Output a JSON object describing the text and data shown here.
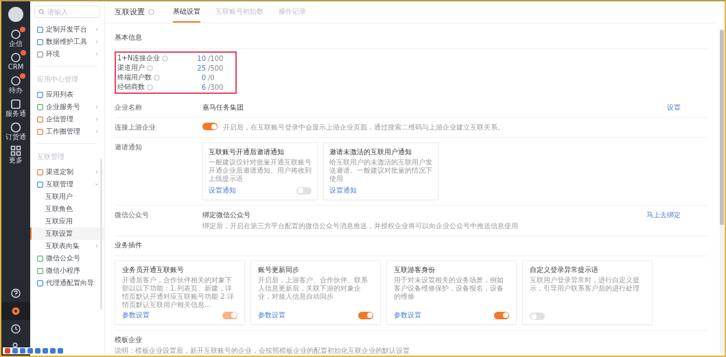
{
  "rail": {
    "items": [
      {
        "label": "企信",
        "badge": true
      },
      {
        "label": "CRM",
        "badge": true
      },
      {
        "label": "待办",
        "badge": true
      },
      {
        "label": "服务通",
        "badge": false
      },
      {
        "label": "订货通",
        "badge": false
      },
      {
        "label": "更多",
        "badge": false
      }
    ],
    "bottom": [
      {
        "selected": false
      },
      {
        "selected": true
      },
      {
        "selected": false
      },
      {
        "selected": false
      }
    ]
  },
  "sidebar": {
    "search": {
      "placeholder": "请输入"
    },
    "groups": [
      {
        "items": [
          {
            "label": "定制开发平台",
            "kind": "submenu",
            "expanded": false,
            "selected": false,
            "color": "#4a8ee0"
          },
          {
            "label": "数据维护工具",
            "kind": "submenu",
            "expanded": false,
            "selected": false,
            "color": "#4a8ee0"
          },
          {
            "label": "环境",
            "kind": "submenu",
            "expanded": false,
            "selected": false,
            "color": "#8a94a6"
          }
        ]
      },
      {
        "title": "应用中心管理",
        "items": [
          {
            "label": "应用列表",
            "kind": "link",
            "selected": false,
            "color": "#4a8ee0"
          },
          {
            "label": "企业服务号",
            "kind": "submenu",
            "expanded": false,
            "selected": false,
            "color": "#52b36b"
          },
          {
            "label": "企信管理",
            "kind": "submenu",
            "expanded": false,
            "selected": false,
            "color": "#f07a2a"
          },
          {
            "label": "工作圈管理",
            "kind": "submenu",
            "expanded": false,
            "selected": false,
            "color": "#f07a2a"
          }
        ]
      },
      {
        "title": "互联管理",
        "items": [
          {
            "label": "渠道定制",
            "kind": "submenu",
            "expanded": false,
            "selected": false,
            "color": "#f07a2a"
          },
          {
            "label": "互联管理",
            "kind": "submenu",
            "expanded": true,
            "selected": false,
            "color": "#4a8ee0",
            "children": [
              {
                "label": "互联用户",
                "selected": false
              },
              {
                "label": "互联角色",
                "selected": false
              },
              {
                "label": "互联应用",
                "selected": false
              },
              {
                "label": "互联设置",
                "selected": true
              },
              {
                "label": "互联表向集",
                "selected": false,
                "kind": "submenu"
              }
            ]
          },
          {
            "label": "微信公众号",
            "kind": "link",
            "selected": false,
            "color": "#52b36b"
          },
          {
            "label": "微信小程序",
            "kind": "link",
            "selected": false,
            "color": "#52b36b"
          },
          {
            "label": "代理通配置向导",
            "kind": "link",
            "selected": false,
            "color": "#4a8ee0"
          }
        ]
      }
    ]
  },
  "header": {
    "title": "互联设置",
    "tabs": [
      {
        "label": "基础设置",
        "selected": true
      },
      {
        "label": "互联账号初始数",
        "selected": false
      },
      {
        "label": "操作记录",
        "selected": false
      }
    ]
  },
  "basic_info": {
    "title": "基本信息",
    "rows": [
      {
        "label": "1+N连接企业",
        "value": "10",
        "limit": "/100"
      },
      {
        "label": "渠道用户",
        "value": "25",
        "limit": "/500"
      },
      {
        "label": "终端用户数",
        "value": "0",
        "limit": "/0"
      },
      {
        "label": "经销商数",
        "value": "6",
        "limit": "/300"
      }
    ]
  },
  "settings": [
    {
      "kind": "text",
      "label": "企业名称",
      "value": "嘉马任务集团",
      "link": "设置"
    },
    {
      "kind": "toggle",
      "label": "连接上游企业",
      "on": true,
      "text": "开启后，在互联账号登录中会显示上游企业页面，通过搜索二维码与上游企业建立互联关系。"
    },
    {
      "kind": "cards",
      "label": "邀请通知",
      "cards": [
        {
          "title": "互联账号开通后邀请通知",
          "text": "一般建议仅针对批量开通互联账号开通企业后邀请通知。用户将收到上线提示语",
          "link": "设置通知",
          "on": false
        },
        {
          "title": "邀请未激活的互联用户通知",
          "text": "给互联用户的未激活的互联用户发送邀请。一般建议对批量的情况下使用",
          "link": "设置通知"
        }
      ]
    },
    {
      "kind": "binding",
      "label": "微信公众号",
      "value": "绑定微信公众号",
      "text": "绑定后，开启在第三方平台配置的微信公众号消息推送，并授权企业将可以向企业公众号中推送信息使用",
      "link": "马上去绑定"
    }
  ],
  "plugins": {
    "title": "业务插件",
    "cards": [
      {
        "title": "业务员开通互联账号",
        "text": "开通后客户，合作伙伴相关的对象下部以以下功能：1.列表页、新建，详情页默认开通对应互联账号功能 2.详情页默认互联用户相关信息...",
        "link": "参数设置",
        "on": true,
        "disabled": true
      },
      {
        "title": "账号更新同步",
        "text": "开启后，上游客户、合作伙伴、联系人信息更新后，关联下游的对象企业，对接人信息自动同步",
        "link": "参数设置",
        "on": true,
        "disabled": false
      },
      {
        "title": "互联游客身份",
        "text": "用于对未设置相关的业务场景，例如客户设备维修保护，设备报名，设备的维修",
        "link": "参数设置",
        "on": true,
        "disabled": false
      },
      {
        "title": "自定义登录异常提示语",
        "text": "互联用户登录异常时，进行自定义提示，引导用户联系客户后的进行处理",
        "on": false,
        "disabled": false
      }
    ]
  },
  "template": {
    "title": "模板企业",
    "text": "说明：模板企业设置后，新开互联账号的企业，会按照模板企业的配置初始化互联企业的默认设置"
  }
}
